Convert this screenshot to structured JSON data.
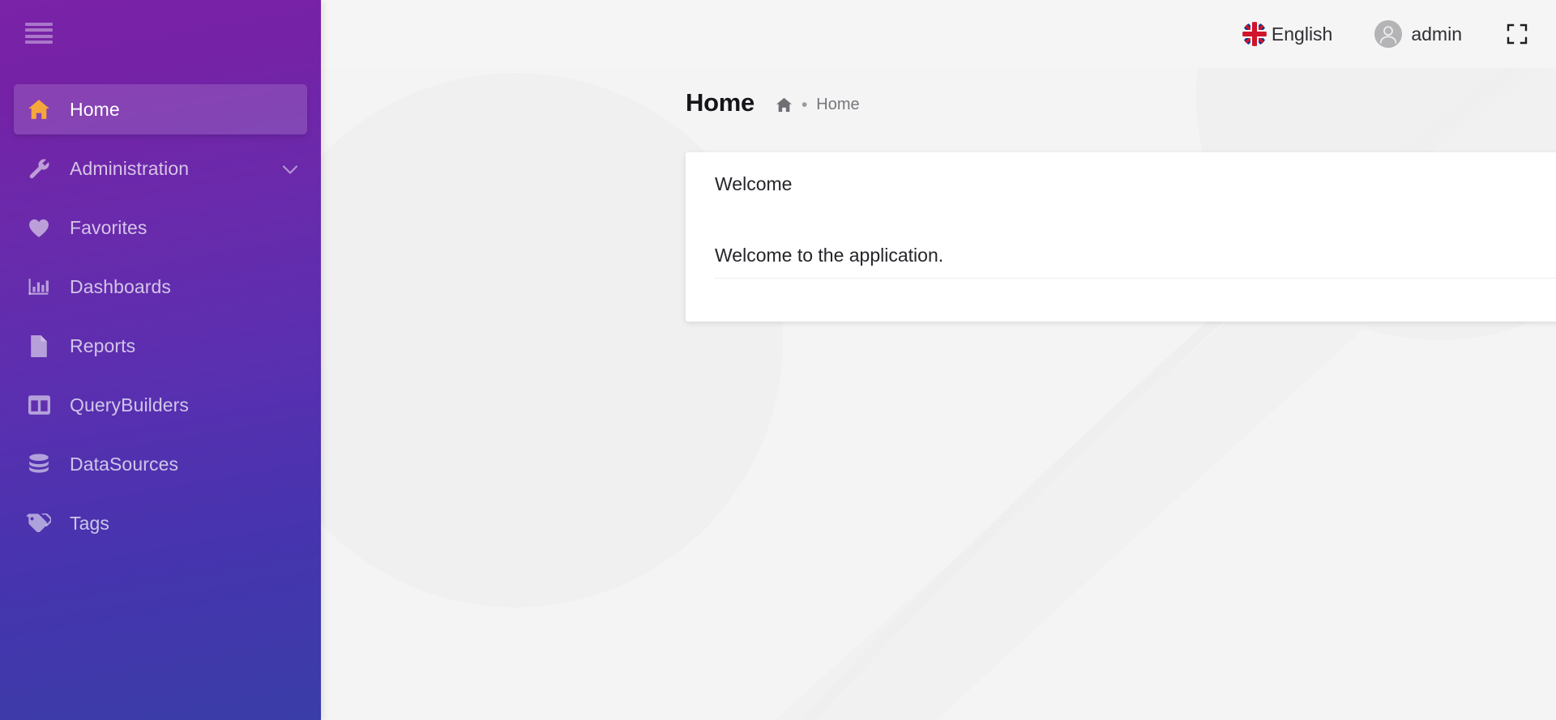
{
  "sidebar": {
    "menu_toggle": {
      "name": "hamburger-menu-toggle",
      "icon": "hamburger-icon",
      "bars": 4
    },
    "items": [
      {
        "label": "Home",
        "icon": "home-icon",
        "active": true,
        "has_submenu": false
      },
      {
        "label": "Administration",
        "icon": "wrench-icon",
        "active": false,
        "has_submenu": true
      },
      {
        "label": "Favorites",
        "icon": "heart-icon",
        "active": false,
        "has_submenu": false
      },
      {
        "label": "Dashboards",
        "icon": "bar-chart-icon",
        "active": false,
        "has_submenu": false
      },
      {
        "label": "Reports",
        "icon": "document-icon",
        "active": false,
        "has_submenu": false
      },
      {
        "label": "QueryBuilders",
        "icon": "columns-layout-icon",
        "active": false,
        "has_submenu": false
      },
      {
        "label": "DataSources",
        "icon": "database-icon",
        "active": false,
        "has_submenu": false
      },
      {
        "label": "Tags",
        "icon": "tag-icon",
        "active": false,
        "has_submenu": false
      }
    ],
    "colors": {
      "gradient_top": "#7a22a8",
      "gradient_bottom": "#3a3da8",
      "active_item_bg": "rgba(255,255,255,0.145)",
      "active_icon": "#f5a73b"
    }
  },
  "topbar": {
    "language": {
      "label": "English",
      "icon": "uk-flag-icon"
    },
    "user": {
      "name": "admin",
      "icon": "user-avatar-icon"
    },
    "fullscreen": {
      "icon": "fullscreen-expand-icon",
      "label": ""
    }
  },
  "page": {
    "title": "Home",
    "breadcrumb": {
      "home_icon": "home-icon",
      "separator": "•",
      "current": "Home"
    }
  },
  "card": {
    "title": "Welcome",
    "body": "Welcome to the application."
  }
}
